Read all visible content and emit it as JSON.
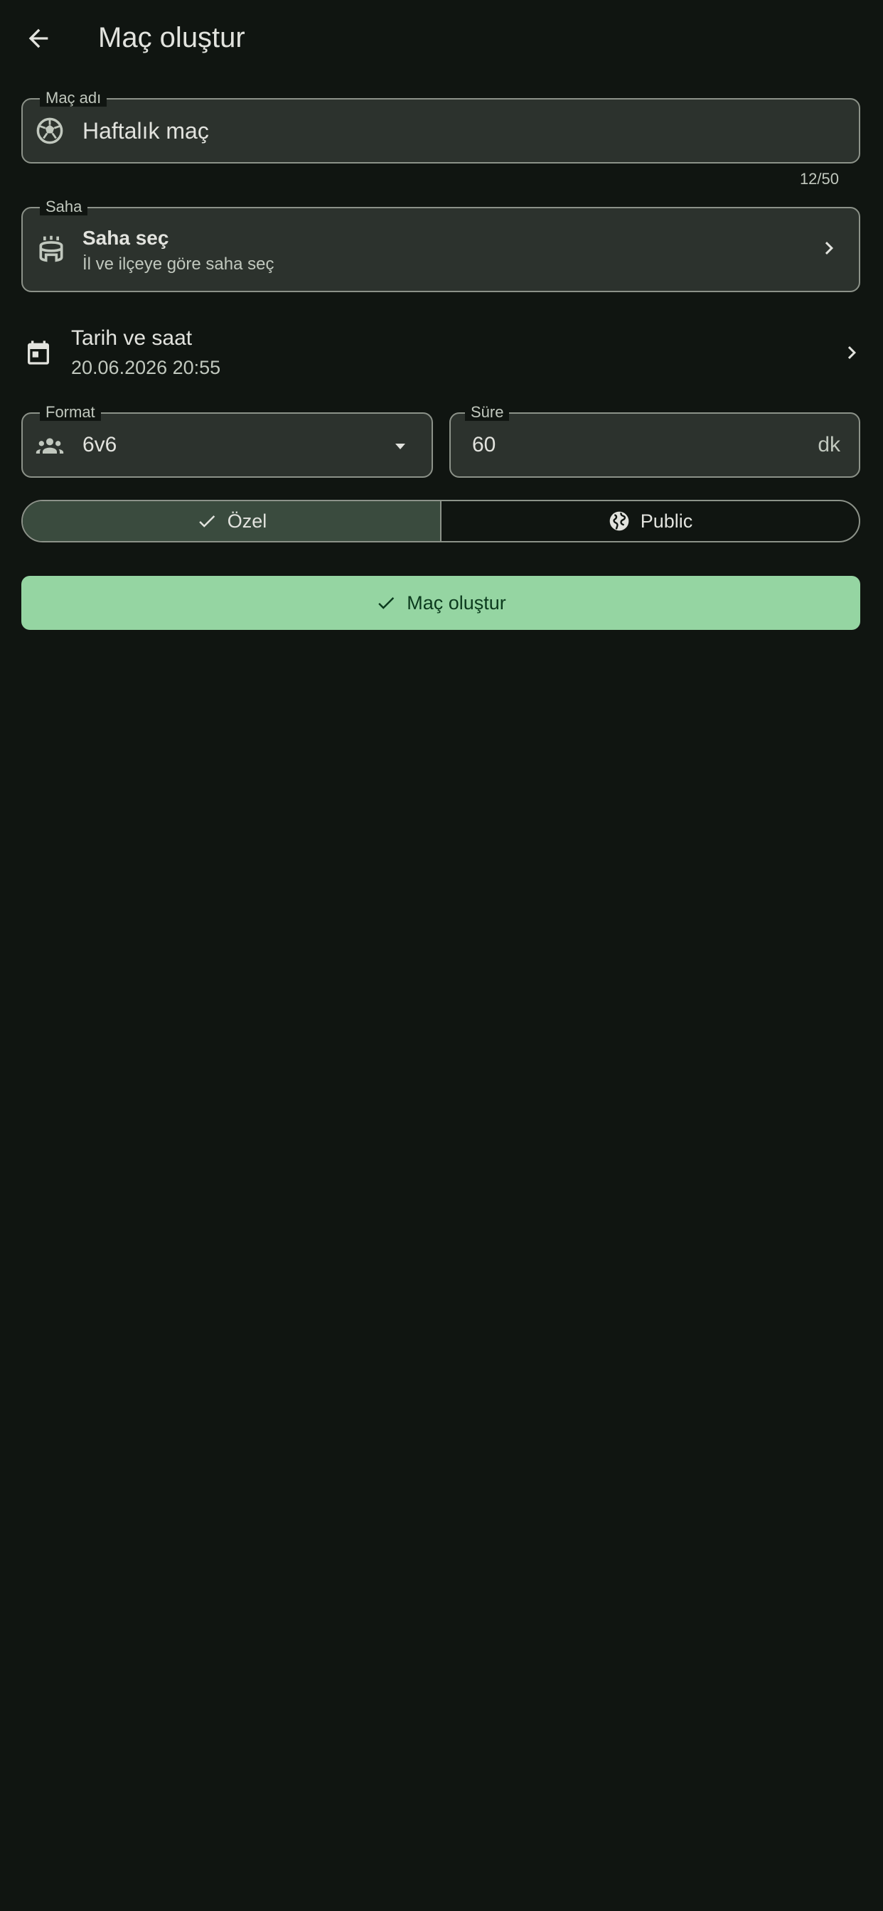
{
  "header": {
    "title": "Maç oluştur",
    "back_icon": "arrow-left-icon"
  },
  "form": {
    "match_name": {
      "label": "Maç adı",
      "value": "Haftalık maç",
      "counter": "12/50",
      "icon": "soccer-ball-icon"
    },
    "pitch": {
      "label": "Saha",
      "title": "Saha seç",
      "subtitle": "İl ve ilçeye göre saha seç",
      "icon": "stadium-icon"
    },
    "datetime": {
      "title": "Tarih ve saat",
      "value": "20.06.2026 20:55",
      "icon": "calendar-icon"
    },
    "format": {
      "label": "Format",
      "value": "6v6",
      "icon": "group-icon"
    },
    "duration": {
      "label": "Süre",
      "value": "60",
      "suffix": "dk"
    },
    "visibility": {
      "options": [
        {
          "label": "Özel",
          "selected": true,
          "icon": "check-icon"
        },
        {
          "label": "Public",
          "selected": false,
          "icon": "globe-icon"
        }
      ]
    },
    "submit_label": "Maç oluştur"
  },
  "colors": {
    "background": "#101511",
    "field_fill": "#2c322d",
    "outline": "#8c9289",
    "selected_segment": "#3a4b3e",
    "primary": "#95d5a2",
    "on_primary": "#0b3a1d"
  }
}
